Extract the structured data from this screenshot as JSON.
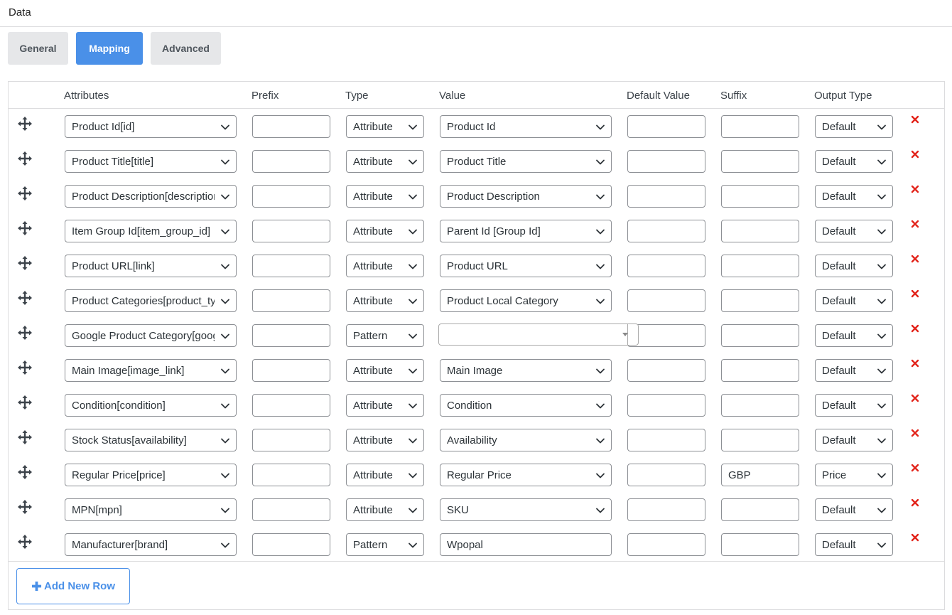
{
  "section": {
    "title": "Data"
  },
  "tabs": [
    {
      "label": "General",
      "active": false
    },
    {
      "label": "Mapping",
      "active": true
    },
    {
      "label": "Advanced",
      "active": false
    }
  ],
  "columns": {
    "attributes": "Attributes",
    "prefix": "Prefix",
    "type": "Type",
    "value": "Value",
    "default_value": "Default Value",
    "suffix": "Suffix",
    "output_type": "Output Type"
  },
  "rows": [
    {
      "attribute": "Product Id[id]",
      "prefix": "",
      "type": "Attribute",
      "value": "Product Id",
      "value_kind": "select",
      "default_value": "",
      "suffix": "",
      "output_type": "Default"
    },
    {
      "attribute": "Product Title[title]",
      "prefix": "",
      "type": "Attribute",
      "value": "Product Title",
      "value_kind": "select",
      "default_value": "",
      "suffix": "",
      "output_type": "Default"
    },
    {
      "attribute": "Product Description[description]",
      "prefix": "",
      "type": "Attribute",
      "value": "Product Description",
      "value_kind": "select",
      "default_value": "",
      "suffix": "",
      "output_type": "Default"
    },
    {
      "attribute": "Item Group Id[item_group_id]",
      "prefix": "",
      "type": "Attribute",
      "value": "Parent Id [Group Id]",
      "value_kind": "select",
      "default_value": "",
      "suffix": "",
      "output_type": "Default"
    },
    {
      "attribute": "Product URL[link]",
      "prefix": "",
      "type": "Attribute",
      "value": "Product URL",
      "value_kind": "select",
      "default_value": "",
      "suffix": "",
      "output_type": "Default"
    },
    {
      "attribute": "Product Categories[product_type]",
      "prefix": "",
      "type": "Attribute",
      "value": "Product Local Category",
      "value_kind": "select",
      "default_value": "",
      "suffix": "",
      "output_type": "Default"
    },
    {
      "attribute": "Google Product Category[google_product_category]",
      "prefix": "",
      "type": "Pattern",
      "value": "",
      "value_kind": "combo",
      "default_value": "",
      "suffix": "",
      "output_type": "Default"
    },
    {
      "attribute": "Main Image[image_link]",
      "prefix": "",
      "type": "Attribute",
      "value": "Main Image",
      "value_kind": "select",
      "default_value": "",
      "suffix": "",
      "output_type": "Default"
    },
    {
      "attribute": "Condition[condition]",
      "prefix": "",
      "type": "Attribute",
      "value": "Condition",
      "value_kind": "select",
      "default_value": "",
      "suffix": "",
      "output_type": "Default"
    },
    {
      "attribute": "Stock Status[availability]",
      "prefix": "",
      "type": "Attribute",
      "value": "Availability",
      "value_kind": "select",
      "default_value": "",
      "suffix": "",
      "output_type": "Default"
    },
    {
      "attribute": "Regular Price[price]",
      "prefix": "",
      "type": "Attribute",
      "value": "Regular Price",
      "value_kind": "select",
      "default_value": "",
      "suffix": "GBP",
      "output_type": "Price"
    },
    {
      "attribute": "MPN[mpn]",
      "prefix": "",
      "type": "Attribute",
      "value": "SKU",
      "value_kind": "select",
      "default_value": "",
      "suffix": "",
      "output_type": "Default"
    },
    {
      "attribute": "Manufacturer[brand]",
      "prefix": "",
      "type": "Pattern",
      "value": "Wpopal",
      "value_kind": "text",
      "default_value": "",
      "suffix": "",
      "output_type": "Default"
    }
  ],
  "footer": {
    "add_row_label": "Add New Row"
  },
  "icons": {
    "drag": "move-arrows-icon",
    "delete": "close-x-icon",
    "chevron": "chevron-down-icon",
    "add": "plus-icon"
  },
  "colors": {
    "accent": "#4a90e8",
    "delete": "#e2231a",
    "tab_inactive": "#e6e7e9"
  }
}
